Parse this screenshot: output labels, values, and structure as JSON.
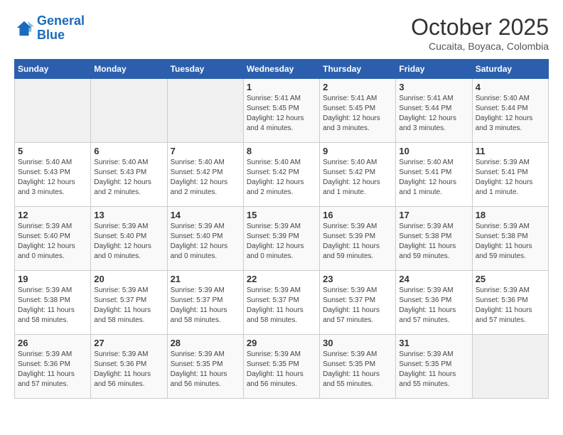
{
  "header": {
    "logo_general": "General",
    "logo_blue": "Blue",
    "month_title": "October 2025",
    "subtitle": "Cucaita, Boyaca, Colombia"
  },
  "weekdays": [
    "Sunday",
    "Monday",
    "Tuesday",
    "Wednesday",
    "Thursday",
    "Friday",
    "Saturday"
  ],
  "weeks": [
    [
      {
        "day": "",
        "info": ""
      },
      {
        "day": "",
        "info": ""
      },
      {
        "day": "",
        "info": ""
      },
      {
        "day": "1",
        "info": "Sunrise: 5:41 AM\nSunset: 5:45 PM\nDaylight: 12 hours\nand 4 minutes."
      },
      {
        "day": "2",
        "info": "Sunrise: 5:41 AM\nSunset: 5:45 PM\nDaylight: 12 hours\nand 3 minutes."
      },
      {
        "day": "3",
        "info": "Sunrise: 5:41 AM\nSunset: 5:44 PM\nDaylight: 12 hours\nand 3 minutes."
      },
      {
        "day": "4",
        "info": "Sunrise: 5:40 AM\nSunset: 5:44 PM\nDaylight: 12 hours\nand 3 minutes."
      }
    ],
    [
      {
        "day": "5",
        "info": "Sunrise: 5:40 AM\nSunset: 5:43 PM\nDaylight: 12 hours\nand 3 minutes."
      },
      {
        "day": "6",
        "info": "Sunrise: 5:40 AM\nSunset: 5:43 PM\nDaylight: 12 hours\nand 2 minutes."
      },
      {
        "day": "7",
        "info": "Sunrise: 5:40 AM\nSunset: 5:42 PM\nDaylight: 12 hours\nand 2 minutes."
      },
      {
        "day": "8",
        "info": "Sunrise: 5:40 AM\nSunset: 5:42 PM\nDaylight: 12 hours\nand 2 minutes."
      },
      {
        "day": "9",
        "info": "Sunrise: 5:40 AM\nSunset: 5:42 PM\nDaylight: 12 hours\nand 1 minute."
      },
      {
        "day": "10",
        "info": "Sunrise: 5:40 AM\nSunset: 5:41 PM\nDaylight: 12 hours\nand 1 minute."
      },
      {
        "day": "11",
        "info": "Sunrise: 5:39 AM\nSunset: 5:41 PM\nDaylight: 12 hours\nand 1 minute."
      }
    ],
    [
      {
        "day": "12",
        "info": "Sunrise: 5:39 AM\nSunset: 5:40 PM\nDaylight: 12 hours\nand 0 minutes."
      },
      {
        "day": "13",
        "info": "Sunrise: 5:39 AM\nSunset: 5:40 PM\nDaylight: 12 hours\nand 0 minutes."
      },
      {
        "day": "14",
        "info": "Sunrise: 5:39 AM\nSunset: 5:40 PM\nDaylight: 12 hours\nand 0 minutes."
      },
      {
        "day": "15",
        "info": "Sunrise: 5:39 AM\nSunset: 5:39 PM\nDaylight: 12 hours\nand 0 minutes."
      },
      {
        "day": "16",
        "info": "Sunrise: 5:39 AM\nSunset: 5:39 PM\nDaylight: 11 hours\nand 59 minutes."
      },
      {
        "day": "17",
        "info": "Sunrise: 5:39 AM\nSunset: 5:38 PM\nDaylight: 11 hours\nand 59 minutes."
      },
      {
        "day": "18",
        "info": "Sunrise: 5:39 AM\nSunset: 5:38 PM\nDaylight: 11 hours\nand 59 minutes."
      }
    ],
    [
      {
        "day": "19",
        "info": "Sunrise: 5:39 AM\nSunset: 5:38 PM\nDaylight: 11 hours\nand 58 minutes."
      },
      {
        "day": "20",
        "info": "Sunrise: 5:39 AM\nSunset: 5:37 PM\nDaylight: 11 hours\nand 58 minutes."
      },
      {
        "day": "21",
        "info": "Sunrise: 5:39 AM\nSunset: 5:37 PM\nDaylight: 11 hours\nand 58 minutes."
      },
      {
        "day": "22",
        "info": "Sunrise: 5:39 AM\nSunset: 5:37 PM\nDaylight: 11 hours\nand 58 minutes."
      },
      {
        "day": "23",
        "info": "Sunrise: 5:39 AM\nSunset: 5:37 PM\nDaylight: 11 hours\nand 57 minutes."
      },
      {
        "day": "24",
        "info": "Sunrise: 5:39 AM\nSunset: 5:36 PM\nDaylight: 11 hours\nand 57 minutes."
      },
      {
        "day": "25",
        "info": "Sunrise: 5:39 AM\nSunset: 5:36 PM\nDaylight: 11 hours\nand 57 minutes."
      }
    ],
    [
      {
        "day": "26",
        "info": "Sunrise: 5:39 AM\nSunset: 5:36 PM\nDaylight: 11 hours\nand 57 minutes."
      },
      {
        "day": "27",
        "info": "Sunrise: 5:39 AM\nSunset: 5:36 PM\nDaylight: 11 hours\nand 56 minutes."
      },
      {
        "day": "28",
        "info": "Sunrise: 5:39 AM\nSunset: 5:35 PM\nDaylight: 11 hours\nand 56 minutes."
      },
      {
        "day": "29",
        "info": "Sunrise: 5:39 AM\nSunset: 5:35 PM\nDaylight: 11 hours\nand 56 minutes."
      },
      {
        "day": "30",
        "info": "Sunrise: 5:39 AM\nSunset: 5:35 PM\nDaylight: 11 hours\nand 55 minutes."
      },
      {
        "day": "31",
        "info": "Sunrise: 5:39 AM\nSunset: 5:35 PM\nDaylight: 11 hours\nand 55 minutes."
      },
      {
        "day": "",
        "info": ""
      }
    ]
  ]
}
